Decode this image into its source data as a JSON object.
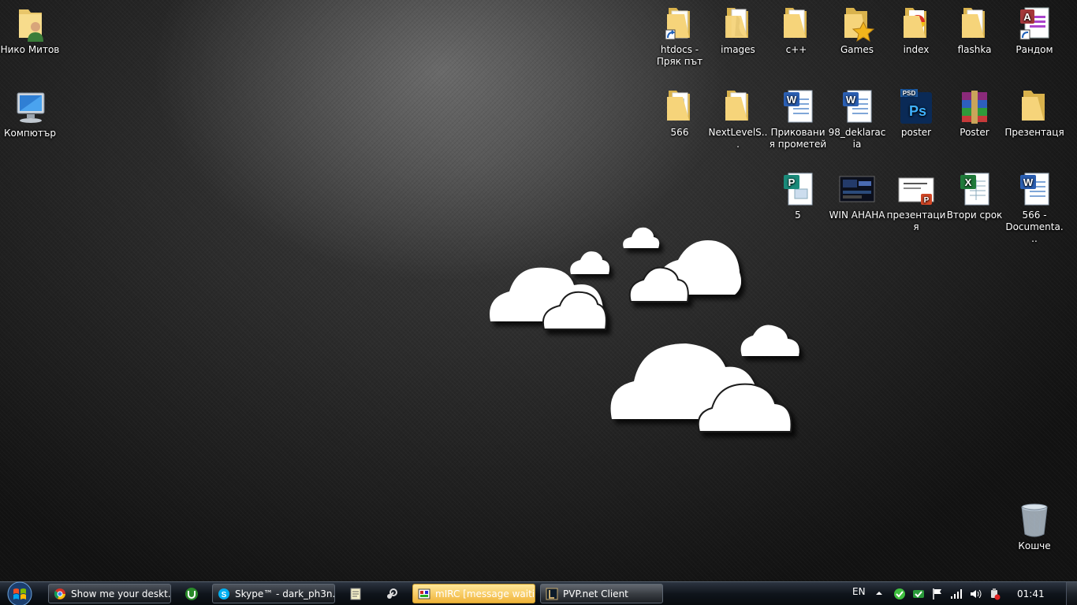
{
  "desktop": {
    "icons_left": [
      {
        "name": "user-folder-icon",
        "label": "Нико Митов",
        "kind": "userfolder"
      },
      {
        "name": "computer-icon",
        "label": "Компютър",
        "kind": "computer"
      }
    ],
    "icons_right": [
      {
        "label": "htdocs - Пряк път",
        "kind": "folder-shortcut"
      },
      {
        "label": "images",
        "kind": "folder-img"
      },
      {
        "label": "c++",
        "kind": "folder"
      },
      {
        "label": "Games",
        "kind": "folder-star"
      },
      {
        "label": "index",
        "kind": "folder-chrome"
      },
      {
        "label": "flashka",
        "kind": "folder"
      },
      {
        "label": "Рандом",
        "kind": "access-shortcut"
      },
      {
        "label": "566",
        "kind": "folder"
      },
      {
        "label": "NextLevelS...",
        "kind": "folder"
      },
      {
        "label": "Прикования прометей",
        "kind": "word"
      },
      {
        "label": "98_deklaracia",
        "kind": "word"
      },
      {
        "label": "poster",
        "kind": "psd"
      },
      {
        "label": "Poster",
        "kind": "rar"
      },
      {
        "label": "Презентаця",
        "kind": "folder"
      },
      {
        "label": "5",
        "kind": "publisher"
      },
      {
        "label": "WIN AHAHA",
        "kind": "screenshot"
      },
      {
        "label": "презентация",
        "kind": "ppt"
      },
      {
        "label": "Втори срок",
        "kind": "excel"
      },
      {
        "label": "566 - Documenta...",
        "kind": "word"
      }
    ],
    "recycle_bin": {
      "label": "Кошче"
    }
  },
  "taskbar": {
    "buttons": [
      {
        "label": "Show me your deskt...",
        "icon": "chrome-icon",
        "state": "normal"
      },
      {
        "label": "Skype™ - dark_ph3n...",
        "icon": "skype-icon",
        "state": "normal"
      },
      {
        "label": "mIRC [message waiti...",
        "icon": "mirc-icon",
        "state": "flash"
      },
      {
        "label": "PVP.net Client",
        "icon": "lol-icon",
        "state": "active"
      }
    ],
    "quick_launch": [
      "utorrent-icon",
      "notepad-icon",
      "steam-icon"
    ],
    "language": "EN",
    "clock": "01:41"
  }
}
